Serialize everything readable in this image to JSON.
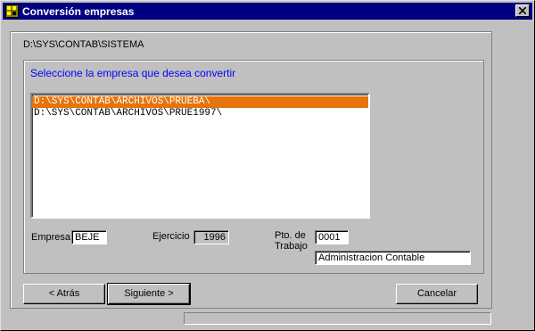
{
  "window": {
    "title": "Conversión empresas",
    "icon": "app-icon",
    "close_icon": "close-icon"
  },
  "path_label": "D:\\SYS\\CONTAB\\SISTEMA",
  "instruction": "Seleccione la empresa que desea convertir",
  "list": {
    "items": [
      {
        "label": "D:\\SYS\\CONTAB\\ARCHIVOS\\PRUEBA\\",
        "selected": true
      },
      {
        "label": "D:\\SYS\\CONTAB\\ARCHIVOS\\PRUE1997\\",
        "selected": false
      }
    ],
    "selected_color": "#e6740b"
  },
  "fields": {
    "empresa_label": "Empresa",
    "empresa_value": "BEJE",
    "ejercicio_label": "Ejercicio",
    "ejercicio_value": "1996",
    "pto_label_line1": "Pto. de",
    "pto_label_line2": "Trabajo",
    "pto_value": "0001",
    "descripcion_value": "Administracion Contable"
  },
  "buttons": {
    "back": "< Atrás",
    "next": "Siguiente >",
    "cancel": "Cancelar"
  },
  "colors": {
    "titlebar": "#000080",
    "face": "#c0c0c0",
    "instruction": "#0000ff"
  }
}
